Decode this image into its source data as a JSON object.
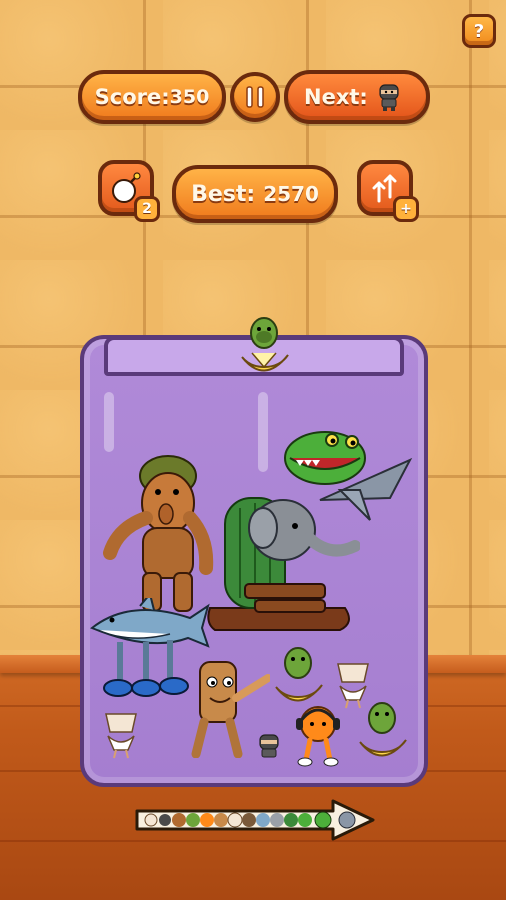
{
  "hud": {
    "help_label": "?",
    "score_label": "Score:",
    "score_value": "350",
    "next_label": "Next:",
    "next_icon": "ninja-icon",
    "pause_icon": "pause-icon",
    "best_label": "Best:",
    "best_value": "2570",
    "bomb_count": "2",
    "upgrade_badge": "+"
  },
  "colors": {
    "button_orange": "#f07a1c",
    "button_border": "#6b2a0d",
    "jar_purple": "#a57ed0",
    "wall_tile": "#efb865",
    "shelf_wood": "#c15a1a"
  },
  "jar_items": [
    "gorilla-banana-icon",
    "bigfoot-icon",
    "crocodile-jet-icon",
    "elephant-cactus-sandal-icon",
    "shark-sneakers-icon",
    "wooden-log-bat-icon",
    "gorilla-banana-icon",
    "teacup-ballerina-icon",
    "teacup-ballerina-icon",
    "ninja-icon",
    "orange-headphones-icon",
    "gorilla-banana-icon"
  ],
  "evolution_chain_icon": "evolution-arrow-icon"
}
